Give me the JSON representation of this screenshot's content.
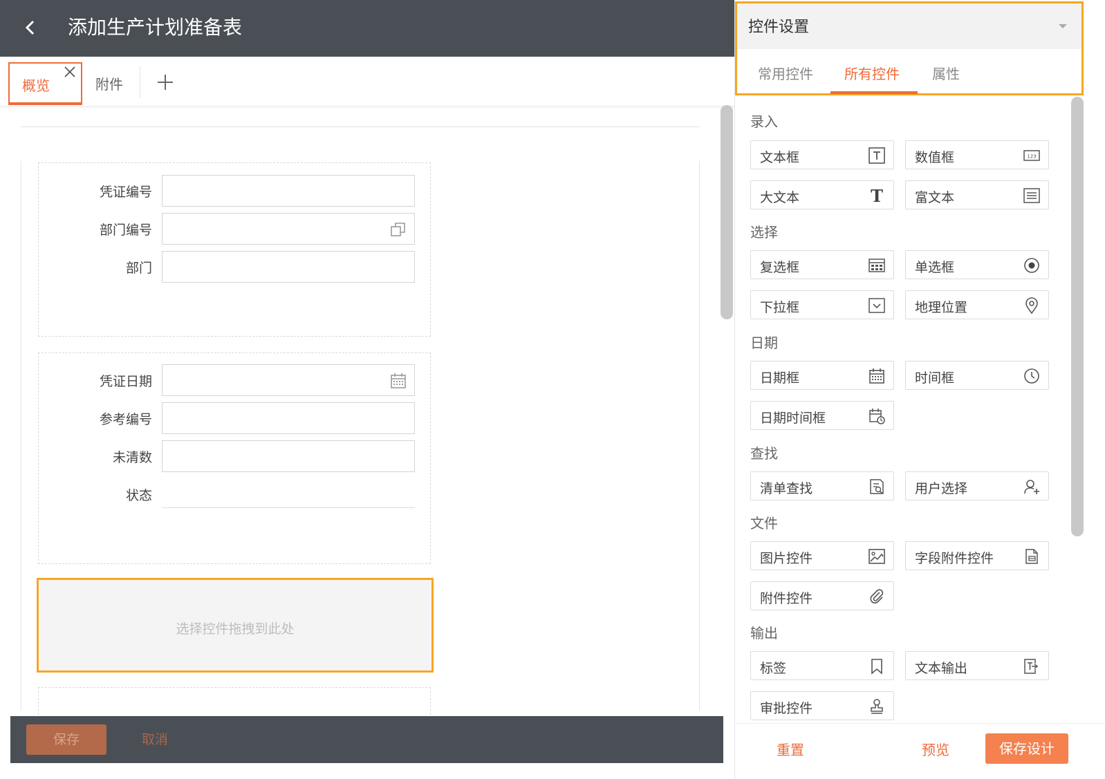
{
  "header": {
    "title": "添加生产计划准备表"
  },
  "tabs": {
    "active": "概览",
    "second": "附件"
  },
  "form": {
    "section1": [
      "凭证编号",
      "部门编号",
      "部门"
    ],
    "section2": [
      "凭证日期",
      "参考编号",
      "未清数",
      "状态"
    ],
    "dropzone": "选择控件拖拽到此处"
  },
  "footer": {
    "save": "保存",
    "cancel": "取消"
  },
  "panel": {
    "title": "控件设置",
    "tabs": [
      "常用控件",
      "所有控件",
      "属性"
    ],
    "active_tab": "所有控件",
    "categories": {
      "input": "录入",
      "select": "选择",
      "date": "日期",
      "lookup": "查找",
      "file": "文件",
      "output": "输出"
    },
    "controls": {
      "textbox": "文本框",
      "number": "数值框",
      "bigtext": "大文本",
      "richtext": "富文本",
      "checkbox": "复选框",
      "radio": "单选框",
      "dropdown": "下拉框",
      "geo": "地理位置",
      "date": "日期框",
      "time": "时间框",
      "datetime": "日期时间框",
      "listlookup": "清单查找",
      "userselect": "用户选择",
      "image": "图片控件",
      "fieldattach": "字段附件控件",
      "attach": "附件控件",
      "label": "标签",
      "textout": "文本输出",
      "approval": "审批控件"
    },
    "footer": {
      "reset": "重置",
      "preview": "预览",
      "save": "保存设计"
    }
  },
  "colors": {
    "accent": "#f06a3a",
    "highlight": "#f5a623",
    "dark_bar": "#4a4f56"
  }
}
